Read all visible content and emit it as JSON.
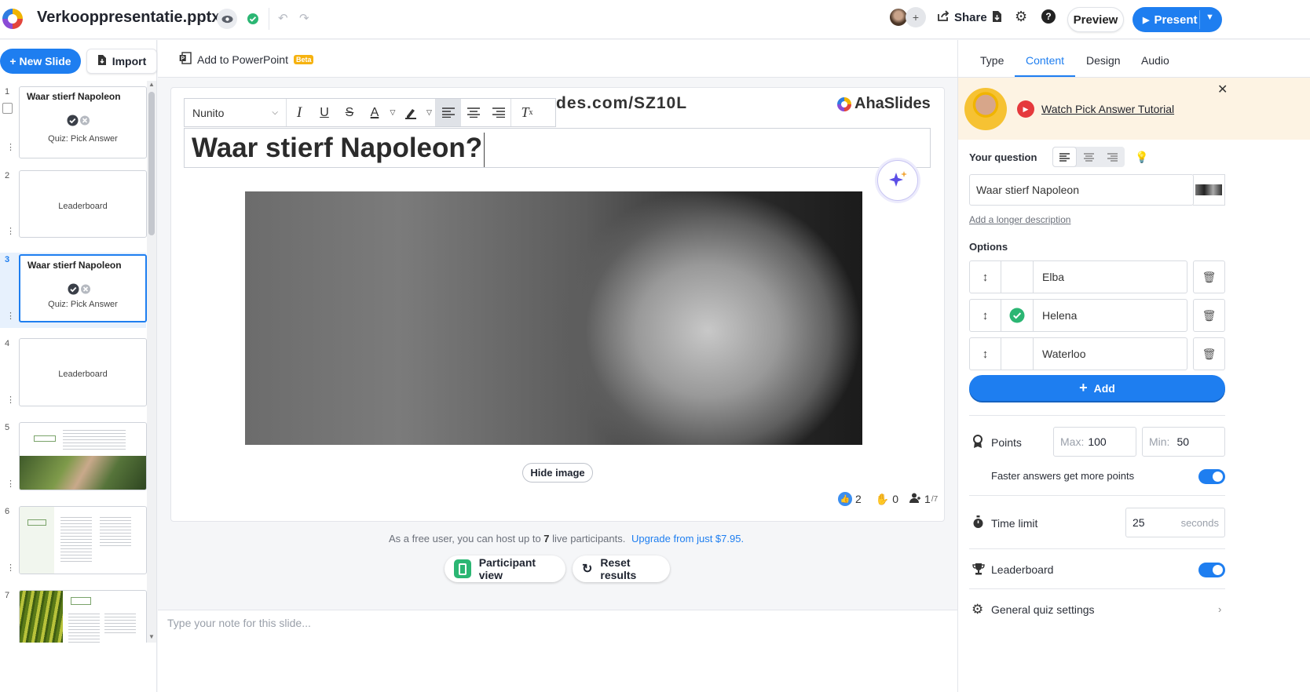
{
  "header": {
    "doc_title": "Verkooppresentatie.pptx",
    "share_label": "Share",
    "preview_label": "Preview",
    "present_label": "Present",
    "add_collaborator": "+"
  },
  "sidebar": {
    "new_slide_label": "+ New Slide",
    "import_label": "Import",
    "slides": [
      {
        "number": "1",
        "title": "Waar stierf Napoleon",
        "subtitle": "Quiz: Pick Answer"
      },
      {
        "number": "2",
        "title": "",
        "subtitle": "Leaderboard"
      },
      {
        "number": "3",
        "title": "Waar stierf Napoleon",
        "subtitle": "Quiz: Pick Answer"
      },
      {
        "number": "4",
        "title": "",
        "subtitle": "Leaderboard"
      },
      {
        "number": "5",
        "title": "",
        "subtitle": ""
      },
      {
        "number": "6",
        "title": "",
        "subtitle": ""
      },
      {
        "number": "7",
        "title": "",
        "subtitle": ""
      }
    ]
  },
  "editor": {
    "add_to_powerpoint": "Add to PowerPoint",
    "beta_badge": "Beta",
    "join_url": "des.com/SZ10L",
    "brand": "AhaSlides",
    "font_name": "Nunito",
    "question_title": "Waar stierf Napoleon?",
    "hide_image_label": "Hide image",
    "stats": {
      "likes": "2",
      "hands": "0",
      "participants": "1",
      "participants_max": "/7"
    },
    "free_notice_prefix": "As a free user, you can host up to ",
    "free_notice_count": "7",
    "free_notice_suffix": " live participants.",
    "upgrade_link": "Upgrade from just $7.95.",
    "participant_view_label": "Participant view",
    "reset_results_label": "Reset results",
    "notes_placeholder": "Type your note for this slide..."
  },
  "right_panel": {
    "tabs": [
      "Type",
      "Content",
      "Design",
      "Audio"
    ],
    "active_tab": "Content",
    "tutorial_link": "Watch Pick Answer Tutorial",
    "your_question_label": "Your question",
    "question_value": "Waar stierf Napoleon",
    "longer_description_link": "Add a longer description",
    "options_label": "Options",
    "options": [
      {
        "text": "Elba",
        "correct": false
      },
      {
        "text": "Helena",
        "correct": true
      },
      {
        "text": "Waterloo",
        "correct": false
      }
    ],
    "add_label": "Add",
    "points_label": "Points",
    "max_label": "Max:",
    "max_value": "100",
    "min_label": "Min:",
    "min_value": "50",
    "faster_answers_label": "Faster answers get more points",
    "time_limit_label": "Time limit",
    "time_limit_value": "25",
    "time_limit_unit": "seconds",
    "leaderboard_label": "Leaderboard",
    "general_settings_label": "General quiz settings"
  },
  "colors": {
    "accent": "#1e7ef0",
    "success": "#2bb673",
    "tutorial_bg": "#fdf3e3",
    "danger": "#e5393d"
  }
}
